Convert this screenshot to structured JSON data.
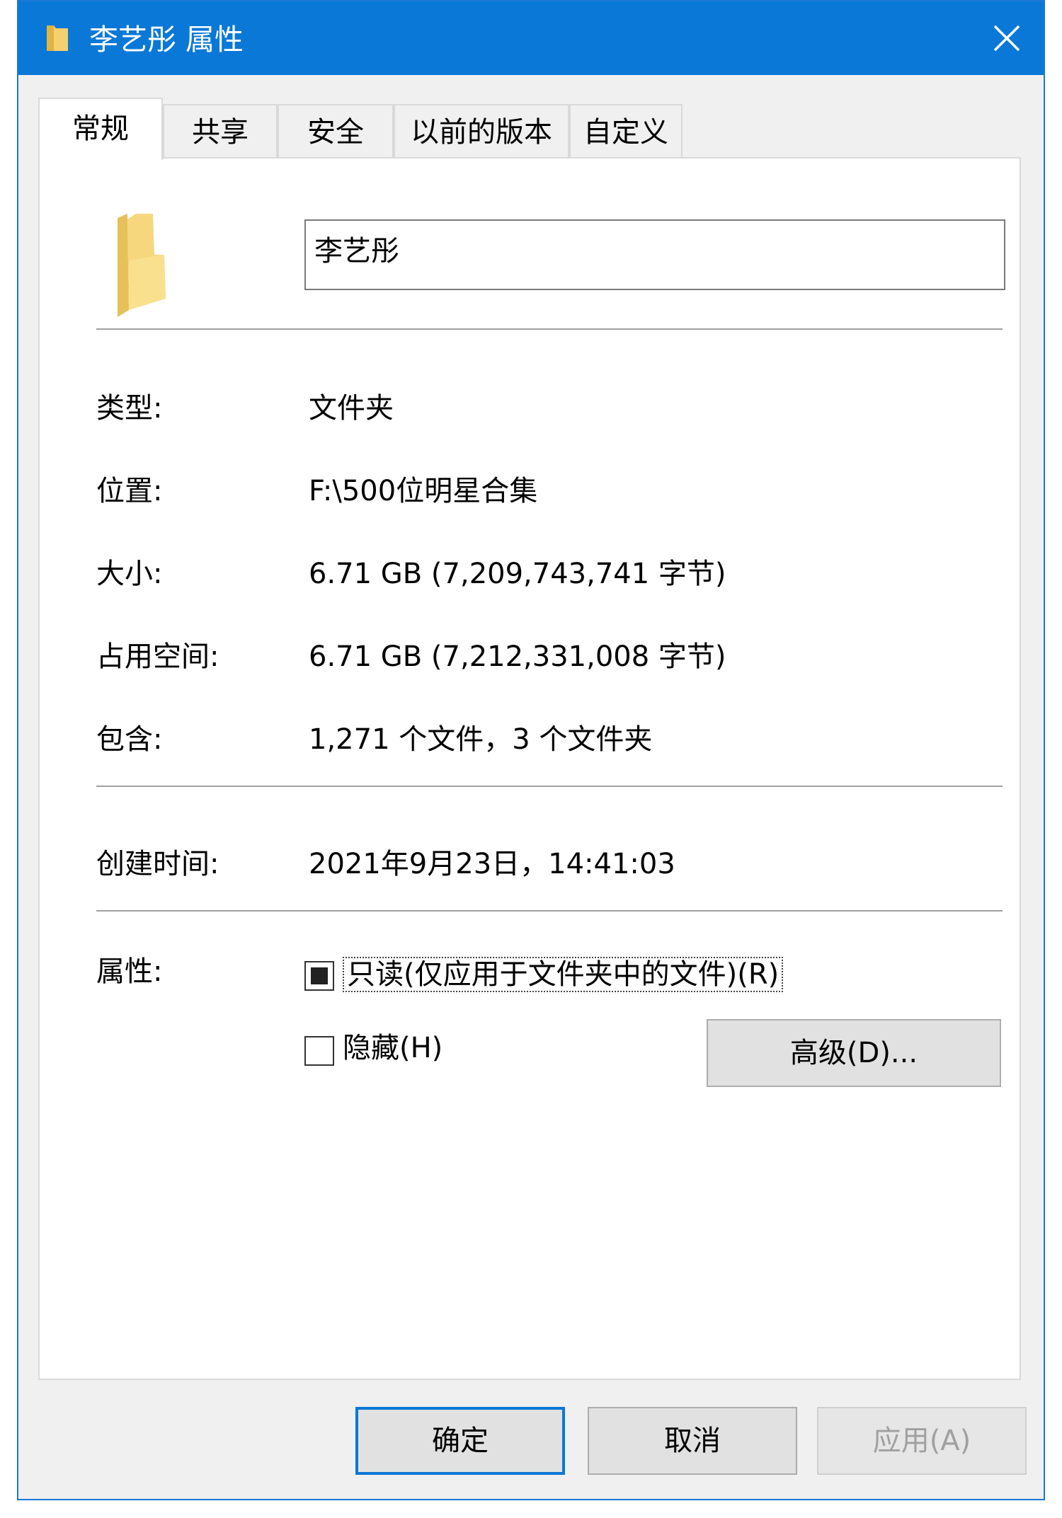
{
  "window": {
    "title": "李艺彤 属性"
  },
  "tabs": [
    "常规",
    "共享",
    "安全",
    "以前的版本",
    "自定义"
  ],
  "general": {
    "name": "李艺彤",
    "type_label": "类型:",
    "type_value": "文件夹",
    "location_label": "位置:",
    "location_value": "F:\\500位明星合集",
    "size_label": "大小:",
    "size_value": "6.71 GB (7,209,743,741 字节)",
    "disk_size_label": "占用空间:",
    "disk_size_value": "6.71 GB (7,212,331,008 字节)",
    "contains_label": "包含:",
    "contains_value": "1,271 个文件，3 个文件夹",
    "created_label": "创建时间:",
    "created_value": "2021年9月23日，14:41:03",
    "attributes_label": "属性:",
    "readonly_label": "只读(仅应用于文件夹中的文件)(R)",
    "readonly_state": "indeterminate",
    "hidden_label": "隐藏(H)",
    "hidden_checked": false,
    "advanced_button": "高级(D)..."
  },
  "buttons": {
    "ok": "确定",
    "cancel": "取消",
    "apply": "应用(A)"
  },
  "colors": {
    "titlebar": "#0a78d7",
    "folder": "#f4d06f"
  }
}
